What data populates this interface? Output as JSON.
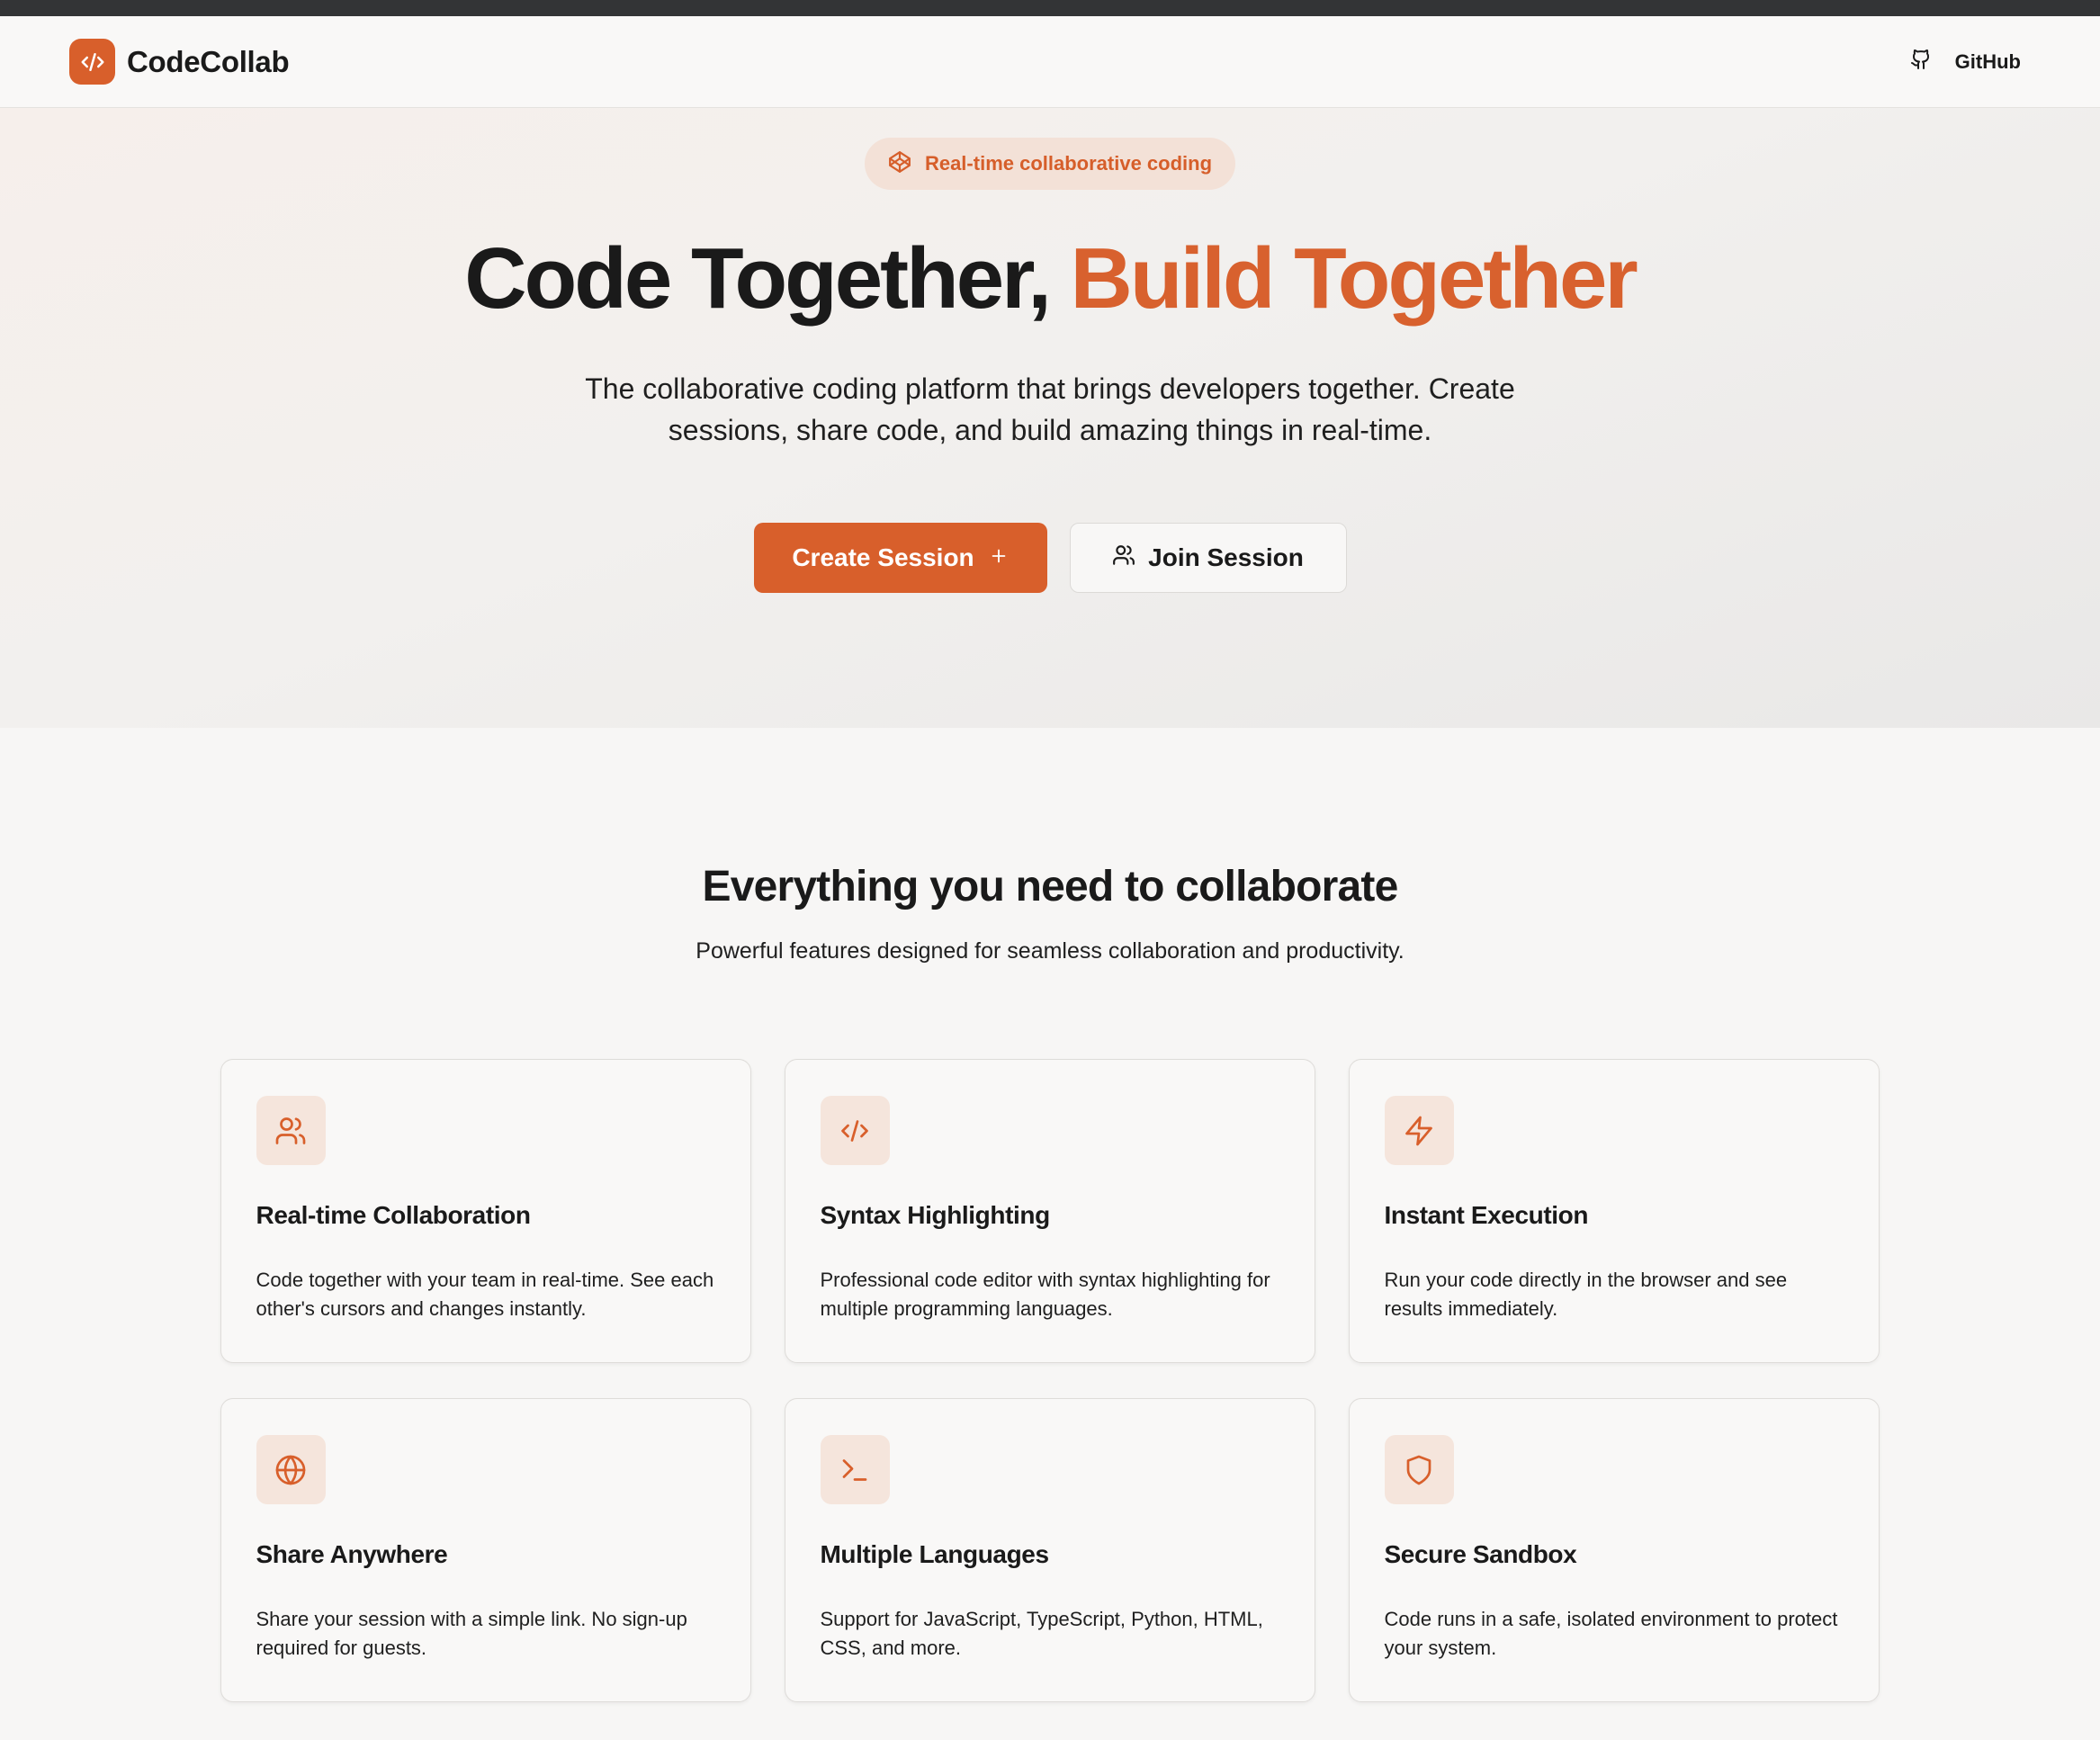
{
  "header": {
    "brand": "CodeCollab",
    "github_label": "GitHub",
    "accent_color": "#d85f2b"
  },
  "hero": {
    "badge": "Real-time collaborative coding",
    "title_main": "Code Together,",
    "title_accent": "Build Together",
    "subtitle": "The collaborative coding platform that brings developers together. Create sessions, share code, and build amazing things in real-time.",
    "create_button": "Create Session",
    "join_button": "Join Session"
  },
  "features": {
    "title": "Everything you need to collaborate",
    "subtitle": "Powerful features designed for seamless collaboration and productivity.",
    "cards": [
      {
        "icon": "users-icon",
        "title": "Real-time Collaboration",
        "description": "Code together with your team in real-time. See each other's cursors and changes instantly."
      },
      {
        "icon": "code-icon",
        "title": "Syntax Highlighting",
        "description": "Professional code editor with syntax highlighting for multiple programming languages."
      },
      {
        "icon": "zap-icon",
        "title": "Instant Execution",
        "description": "Run your code directly in the browser and see results immediately."
      },
      {
        "icon": "globe-icon",
        "title": "Share Anywhere",
        "description": "Share your session with a simple link. No sign-up required for guests."
      },
      {
        "icon": "terminal-icon",
        "title": "Multiple Languages",
        "description": "Support for JavaScript, TypeScript, Python, HTML, CSS, and more."
      },
      {
        "icon": "shield-icon",
        "title": "Secure Sandbox",
        "description": "Code runs in a safe, isolated environment to protect your system."
      }
    ]
  }
}
